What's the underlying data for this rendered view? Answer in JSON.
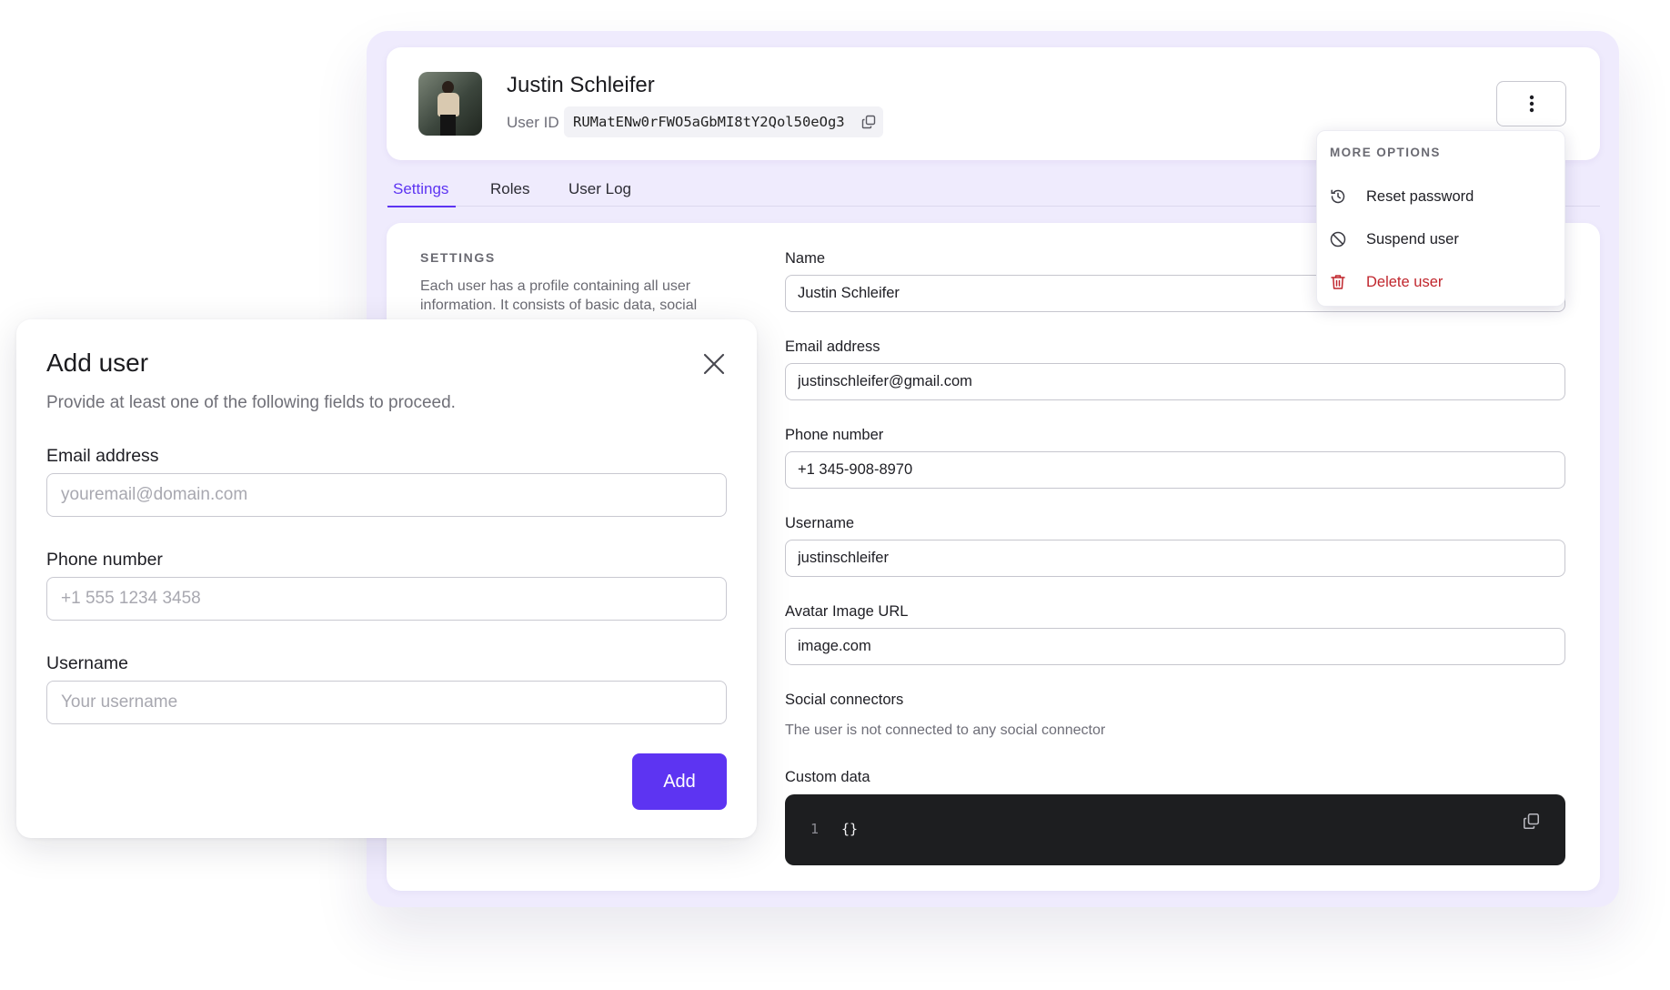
{
  "user": {
    "name": "Justin Schleifer",
    "user_id_label": "User ID",
    "user_id": "RUMatENw0rFWO5aGbMI8tY2Qol50eOg3"
  },
  "tabs": [
    {
      "label": "Settings",
      "active": true
    },
    {
      "label": "Roles",
      "active": false
    },
    {
      "label": "User Log",
      "active": false
    }
  ],
  "settings": {
    "title": "SETTINGS",
    "description": "Each user has a profile containing all user information. It consists of basic data, social",
    "fields": {
      "name": {
        "label": "Name",
        "value": "Justin Schleifer"
      },
      "email": {
        "label": "Email address",
        "value": "justinschleifer@gmail.com"
      },
      "phone": {
        "label": "Phone number",
        "value": "+1 345-908-8970"
      },
      "username": {
        "label": "Username",
        "value": "justinschleifer"
      },
      "avatar_url": {
        "label": "Avatar Image URL",
        "value": "image.com"
      }
    },
    "social": {
      "label": "Social connectors",
      "text": "The user is not connected to any social connector"
    },
    "custom_data": {
      "label": "Custom data",
      "line_number": "1",
      "code": "{}"
    }
  },
  "more_menu": {
    "title": "MORE OPTIONS",
    "items": [
      {
        "label": "Reset password",
        "icon": "reset-icon"
      },
      {
        "label": "Suspend user",
        "icon": "suspend-icon"
      },
      {
        "label": "Delete user",
        "icon": "trash-icon",
        "color": "#c0262d"
      }
    ]
  },
  "add_user_modal": {
    "title": "Add user",
    "subtitle": "Provide at least one of the following fields to proceed.",
    "email": {
      "label": "Email address",
      "placeholder": "youremail@domain.com"
    },
    "phone": {
      "label": "Phone number",
      "placeholder": "+1 555 1234 3458"
    },
    "username": {
      "label": "Username",
      "placeholder": "Your username"
    },
    "submit_label": "Add"
  },
  "colors": {
    "accent": "#5d34f2",
    "panel_bg": "#efebfd",
    "danger": "#c0262d",
    "code_bg": "#1d1e20"
  }
}
